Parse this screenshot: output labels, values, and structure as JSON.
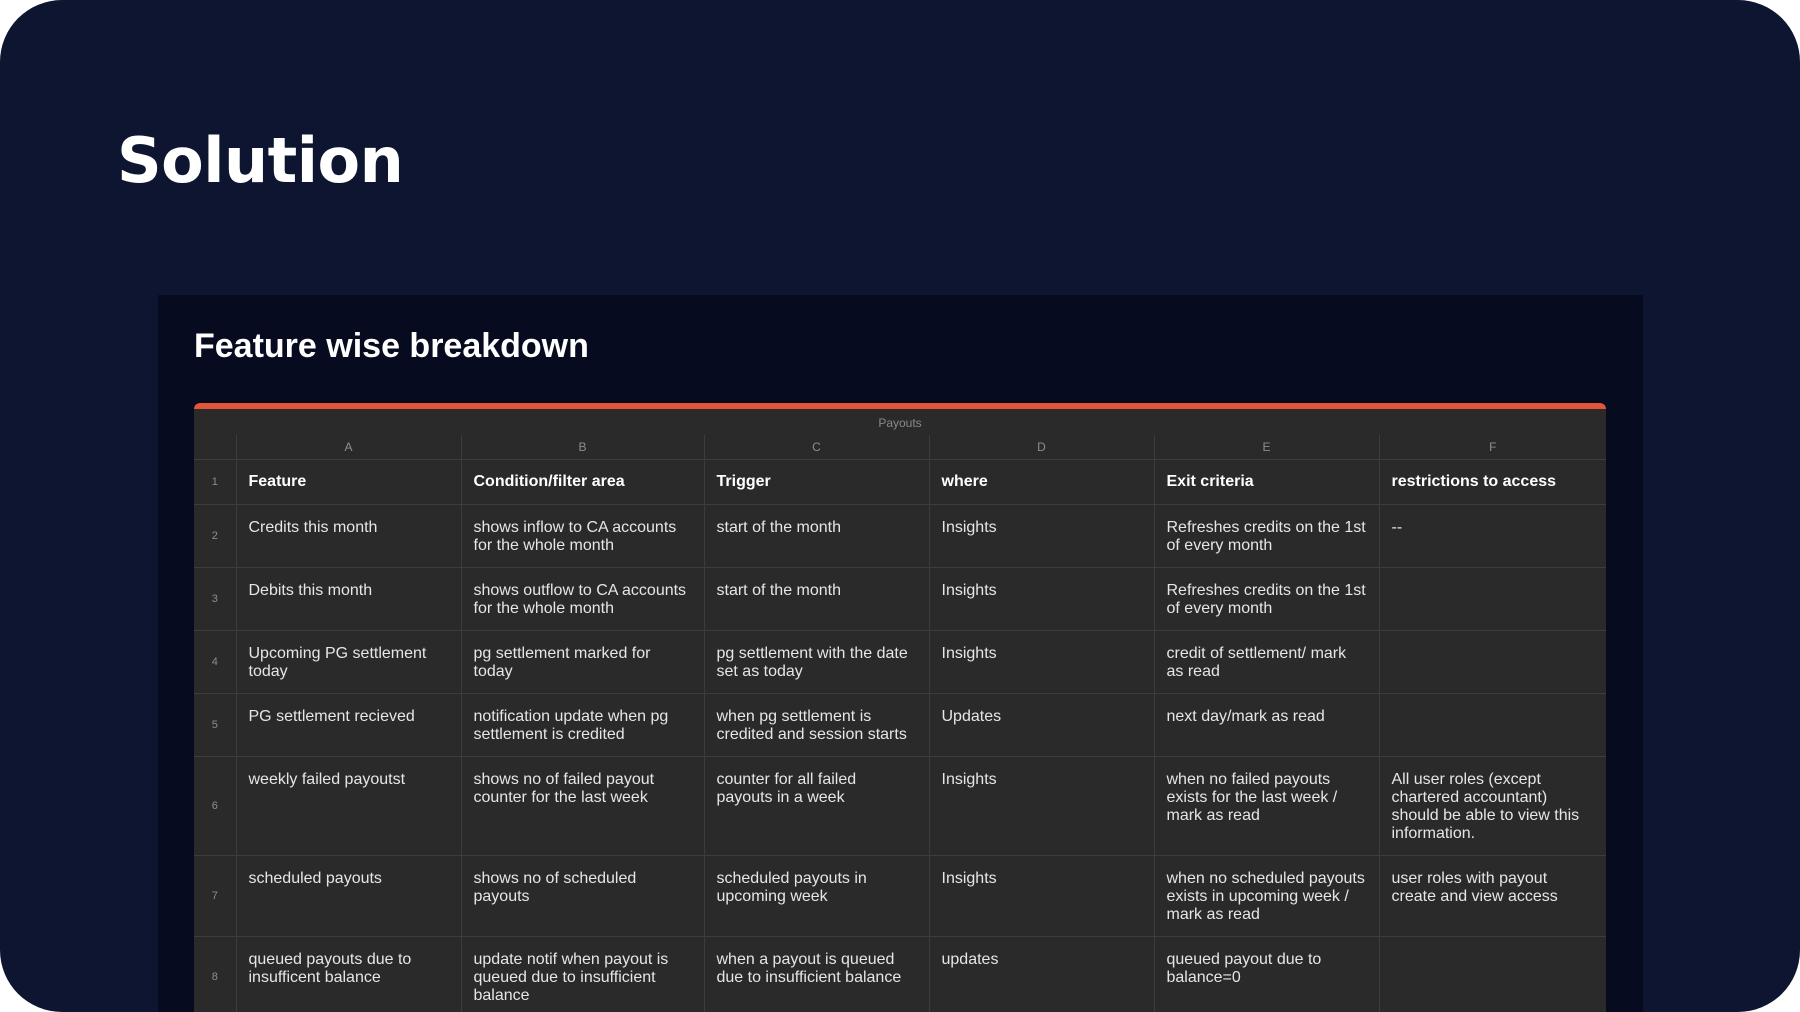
{
  "slide": {
    "title": "Solution"
  },
  "panel": {
    "title": "Feature wise breakdown"
  },
  "sheet": {
    "name": "Payouts",
    "column_letters": [
      "A",
      "B",
      "C",
      "D",
      "E",
      "F"
    ],
    "header_row_number": "1",
    "headers": [
      "Feature",
      "Condition/filter area",
      "Trigger",
      "where",
      "Exit criteria",
      "restrictions to access"
    ],
    "rows": [
      {
        "n": "2",
        "cells": [
          "Credits this month",
          "shows inflow to CA accounts for the whole month",
          "start of the month",
          "Insights",
          "Refreshes credits on the 1st of every month",
          "--"
        ]
      },
      {
        "n": "3",
        "cells": [
          "Debits this month",
          "shows outflow to CA accounts for the whole month",
          "start of the month",
          "Insights",
          "Refreshes credits on the 1st of every month",
          ""
        ]
      },
      {
        "n": "4",
        "cells": [
          "Upcoming PG settlement today",
          "pg settlement marked for today",
          "pg settlement with the date set as today",
          "Insights",
          "credit of settlement/ mark as read",
          ""
        ]
      },
      {
        "n": "5",
        "cells": [
          "PG settlement recieved",
          "notification update when pg settlement is credited",
          "when pg settlement is credited and session starts",
          "Updates",
          "next day/mark as read",
          ""
        ]
      },
      {
        "n": "6",
        "cells": [
          "weekly failed payoutst",
          "shows no of failed payout counter for the last week",
          "counter for all failed payouts in a week",
          "Insights",
          "when no failed payouts exists for the last week / mark as read",
          "All user roles (except chartered accountant) should be able to view this information."
        ]
      },
      {
        "n": "7",
        "cells": [
          "scheduled payouts",
          "shows no of scheduled payouts",
          "scheduled payouts in upcoming week",
          "Insights",
          "when no scheduled payouts exists in upcoming week / mark as read",
          "user roles with payout create and view access"
        ]
      },
      {
        "n": "8",
        "cells": [
          "queued payouts due to insufficent balance",
          "update notif when payout is queued due to insufficient balance",
          "when a payout is queued due to insufficient balance",
          "updates",
          "queued payout due to balance=0",
          ""
        ]
      }
    ]
  }
}
